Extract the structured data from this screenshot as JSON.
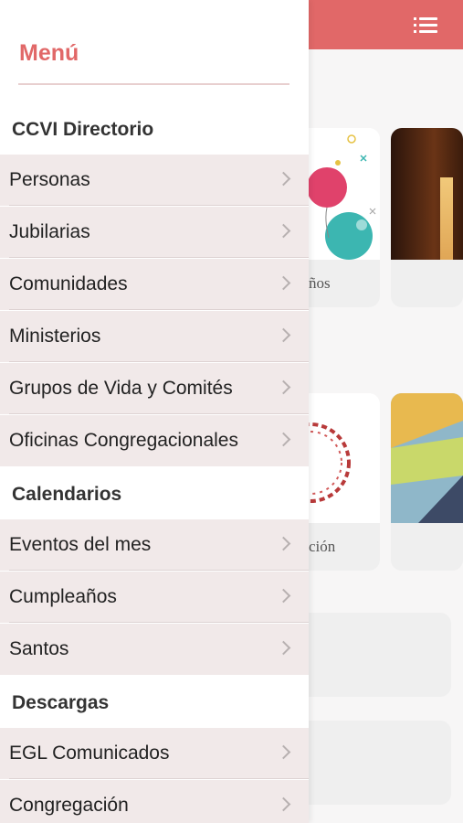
{
  "background": {
    "cards": [
      {
        "label": "ños"
      },
      {
        "label": "ción"
      }
    ]
  },
  "drawer": {
    "title": "Menú",
    "sections": [
      {
        "heading": "CCVI Directorio",
        "items": [
          "Personas",
          "Jubilarias",
          "Comunidades",
          "Ministerios",
          "Grupos de Vida y Comités",
          "Oficinas Congregacionales"
        ]
      },
      {
        "heading": "Calendarios",
        "items": [
          "Eventos del mes",
          "Cumpleaños",
          "Santos"
        ]
      },
      {
        "heading": "Descargas",
        "items": [
          "EGL Comunicados",
          "Congregación"
        ]
      }
    ]
  },
  "colors": {
    "accent": "#e16868",
    "item_bg": "#f1e9e9"
  },
  "icons": {
    "menu": "list-icon",
    "chevron": "chevron-right-icon"
  }
}
